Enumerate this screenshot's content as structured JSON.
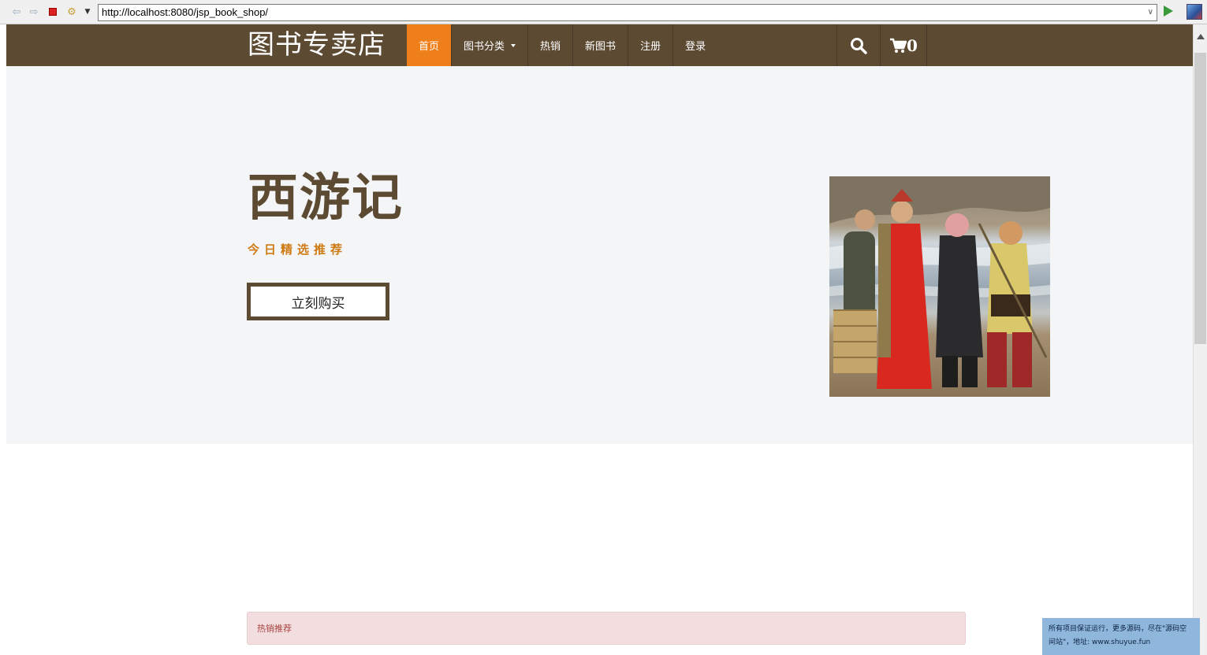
{
  "browser": {
    "url": "http://localhost:8080/jsp_book_shop/"
  },
  "navbar": {
    "brand": "图书专卖店",
    "items": [
      {
        "label": "首页",
        "active": true
      },
      {
        "label": "图书分类",
        "dropdown": true
      },
      {
        "label": "热销"
      },
      {
        "label": "新图书"
      },
      {
        "label": "注册"
      },
      {
        "label": "登录"
      }
    ],
    "cart_count": "0",
    "icons": [
      "search-icon",
      "cart-icon"
    ]
  },
  "hero": {
    "title": "西游记",
    "subtitle": "今日精选推荐",
    "buy_label": "立刻购买"
  },
  "hot": {
    "label": "热销推荐"
  },
  "watermark": {
    "text": "所有项目保证运行，更多源码，尽在\"源码空间站\"，地址: www.shuyue.fun"
  },
  "colors": {
    "navbar_bg": "#5c4a33",
    "active_item": "#ef7f1a",
    "hero_bg": "#f3f5f7",
    "subtitle": "#d07a14"
  }
}
